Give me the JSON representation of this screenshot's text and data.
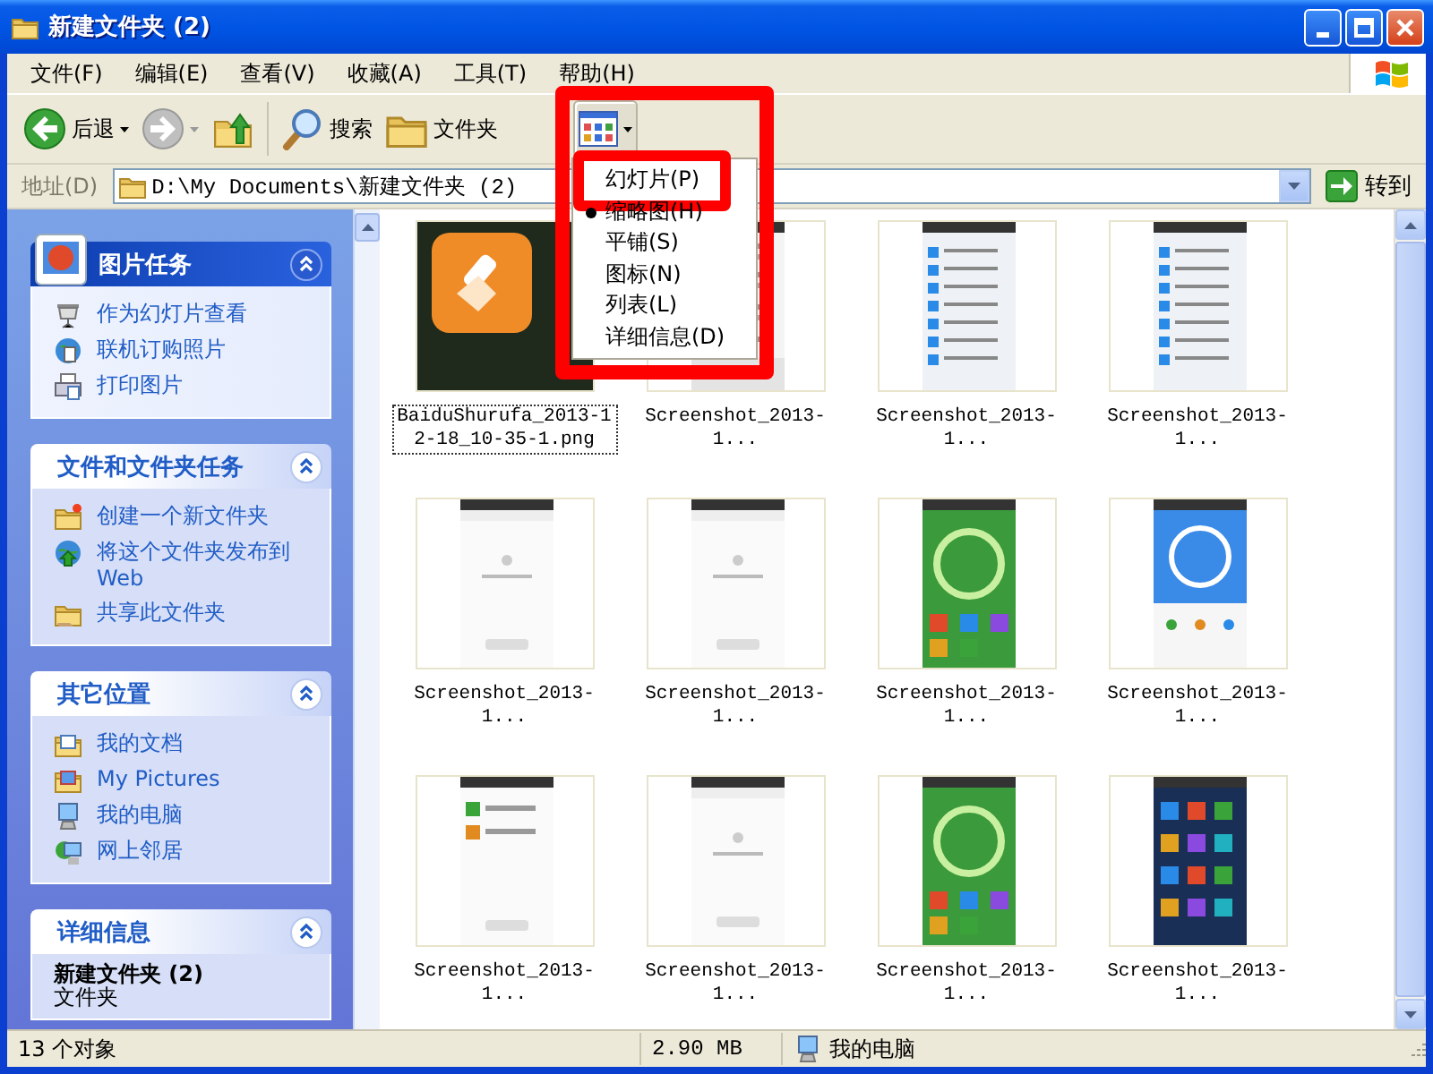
{
  "window": {
    "title": "新建文件夹 (2)"
  },
  "menu_bar": [
    "文件(F)",
    "编辑(E)",
    "查看(V)",
    "收藏(A)",
    "工具(T)",
    "帮助(H)"
  ],
  "toolbar": [
    {
      "kind": "back",
      "label": "后退",
      "disabled": false
    },
    {
      "kind": "forward",
      "disabled": true
    },
    {
      "kind": "up"
    },
    {
      "kind": "search",
      "label": "搜索"
    },
    {
      "kind": "folders",
      "label": "文件夹"
    },
    {
      "kind": "views",
      "pressed": true
    }
  ],
  "address": {
    "label": "地址(D)",
    "value": "D:\\My Documents\\新建文件夹 (2)",
    "go": "转到"
  },
  "view_menu": {
    "highlighted": true,
    "items": [
      {
        "label": "幻灯片(P)",
        "selected": false,
        "highlighted": true
      },
      {
        "label": "缩略图(H)",
        "selected": true,
        "highlighted": false
      },
      {
        "label": "平铺(S)",
        "selected": false,
        "highlighted": false
      },
      {
        "label": "图标(N)",
        "selected": false,
        "highlighted": false
      },
      {
        "label": "列表(L)",
        "selected": false,
        "highlighted": false
      },
      {
        "label": "详细信息(D)",
        "selected": false,
        "highlighted": false
      }
    ]
  },
  "task_panes": [
    {
      "kind": "primary",
      "title": "图片任务",
      "expanded": true,
      "links": [
        "作为幻灯片查看",
        "联机订购照片",
        "打印图片"
      ]
    },
    {
      "kind": "links",
      "title": "文件和文件夹任务",
      "expanded": true,
      "links": [
        "创建一个新文件夹",
        "将这个文件夹发布到 Web",
        "共享此文件夹"
      ]
    },
    {
      "kind": "links",
      "title": "其它位置",
      "expanded": true,
      "links": [
        "我的文档",
        "My Pictures",
        "我的电脑",
        "网上邻居"
      ]
    },
    {
      "kind": "details",
      "title": "详细信息",
      "expanded": true,
      "name": "新建文件夹 (2)",
      "type": "文件夹"
    }
  ],
  "files": [
    {
      "name": "BaiduShurufa_2013-12-18_10-35-1.png",
      "selected": true
    },
    {
      "name": "Screenshot_2013-1...",
      "selected": false
    },
    {
      "name": "Screenshot_2013-1...",
      "selected": false
    },
    {
      "name": "Screenshot_2013-1...",
      "selected": false
    },
    {
      "name": "Screenshot_2013-1...",
      "selected": false
    },
    {
      "name": "Screenshot_2013-1...",
      "selected": false
    },
    {
      "name": "Screenshot_2013-1...",
      "selected": false
    },
    {
      "name": "Screenshot_2013-1...",
      "selected": false
    },
    {
      "name": "Screenshot_2013-1...",
      "selected": false
    },
    {
      "name": "Screenshot_2013-1...",
      "selected": false
    },
    {
      "name": "Screenshot_2013-1...",
      "selected": false
    },
    {
      "name": "Screenshot_2013-1...",
      "selected": false
    }
  ],
  "status_bar": {
    "count": "13 个对象",
    "size": "2.90 MB",
    "location": "我的电脑"
  }
}
